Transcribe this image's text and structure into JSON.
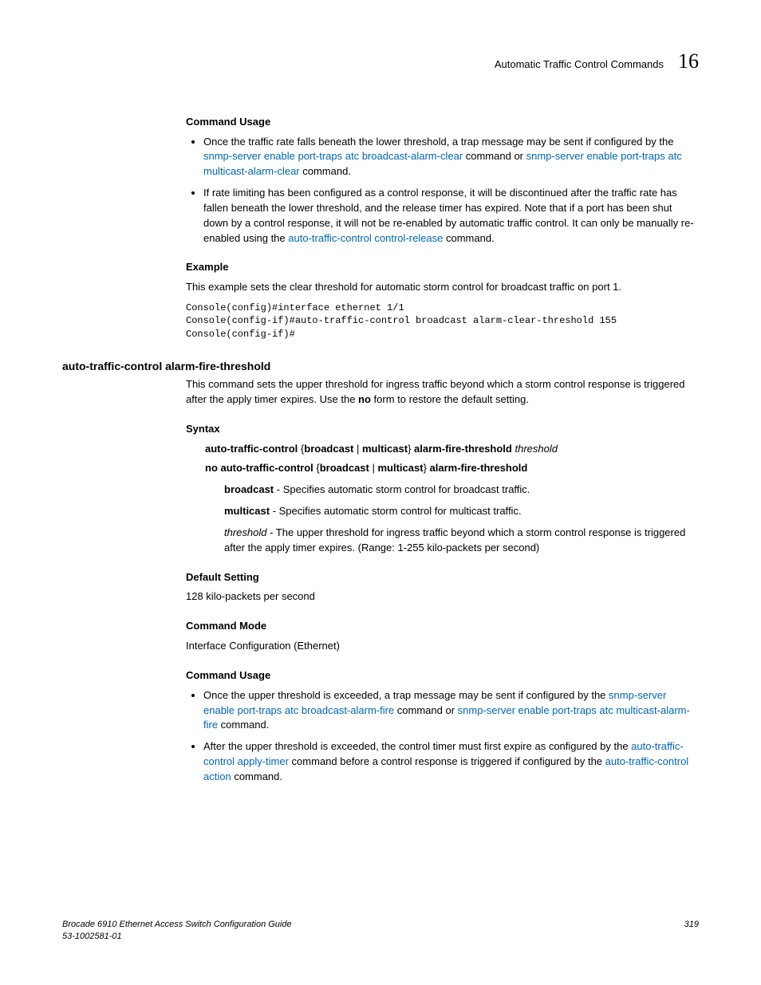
{
  "header": {
    "title": "Automatic Traffic Control Commands",
    "chapter": "16"
  },
  "s1": {
    "heading": "Command Usage",
    "b1_pre": "Once the traffic rate falls beneath the lower threshold, a trap message may be sent if configured by the ",
    "b1_link1": "snmp-server enable port-traps atc broadcast-alarm-clear",
    "b1_mid": " command or ",
    "b1_link2": "snmp-server enable port-traps atc multicast-alarm-clear",
    "b1_post": " command.",
    "b2_pre": "If rate limiting has been configured as a control response, it will be discontinued after the traffic rate has fallen beneath the lower threshold, and the release timer has expired. Note that if a port has been shut down by a control response, it will not be re-enabled by automatic traffic control. It can only be manually re-enabled using the ",
    "b2_link": "auto-traffic-control control-release",
    "b2_post": " command."
  },
  "example": {
    "heading": "Example",
    "text": "This example sets the clear threshold for automatic storm control for broadcast traffic on port 1.",
    "code": "Console(config)#interface ethernet 1/1\nConsole(config-if)#auto-traffic-control broadcast alarm-clear-threshold 155\nConsole(config-if)#"
  },
  "cmd2": {
    "name": "auto-traffic-control alarm-fire-threshold",
    "desc_pre": "This command sets the upper threshold for ingress traffic beyond which a storm control response is triggered after the apply timer expires. Use the ",
    "desc_bold": "no",
    "desc_post": " form to restore the default setting."
  },
  "syntax": {
    "heading": "Syntax",
    "line1_a": "auto-traffic-control",
    "line1_b": " {",
    "line1_c": "broadcast",
    "line1_d": " | ",
    "line1_e": "multicast",
    "line1_f": "} ",
    "line1_g": "alarm-fire-threshold",
    "line1_h": " threshold",
    "line2_a": "no auto-traffic-control",
    "line2_b": " {",
    "line2_c": "broadcast",
    "line2_d": " | ",
    "line2_e": "multicast",
    "line2_f": "} ",
    "line2_g": "alarm-fire-threshold",
    "p1_term": "broadcast",
    "p1_desc": " - Specifies automatic storm control for broadcast traffic.",
    "p2_term": "multicast",
    "p2_desc": " - Specifies automatic storm control for multicast traffic.",
    "p3_term": "threshold",
    "p3_desc": " - The upper threshold for ingress traffic beyond which a storm control response is triggered after the apply timer expires. (Range: 1-255 kilo-packets per second)"
  },
  "default": {
    "heading": "Default Setting",
    "text": "128 kilo-packets per second"
  },
  "mode": {
    "heading": "Command Mode",
    "text": "Interface Configuration (Ethernet)"
  },
  "usage2": {
    "heading": "Command Usage",
    "b1_pre": "Once the upper threshold is exceeded, a trap message may be sent if configured by the ",
    "b1_link1": "snmp-server enable port-traps atc broadcast-alarm-fire",
    "b1_mid": " command or ",
    "b1_link2": "snmp-server enable port-traps atc multicast-alarm-fire",
    "b1_post": " command.",
    "b2_pre": "After the upper threshold is exceeded, the control timer must first expire as configured by the ",
    "b2_link1": "auto-traffic-control apply-timer",
    "b2_mid": " command before a control response is triggered if configured by the ",
    "b2_link2": "auto-traffic-control action",
    "b2_post": " command."
  },
  "footer": {
    "line1": "Brocade 6910 Ethernet Access Switch Configuration Guide",
    "line2": "53-1002581-01",
    "page": "319"
  }
}
